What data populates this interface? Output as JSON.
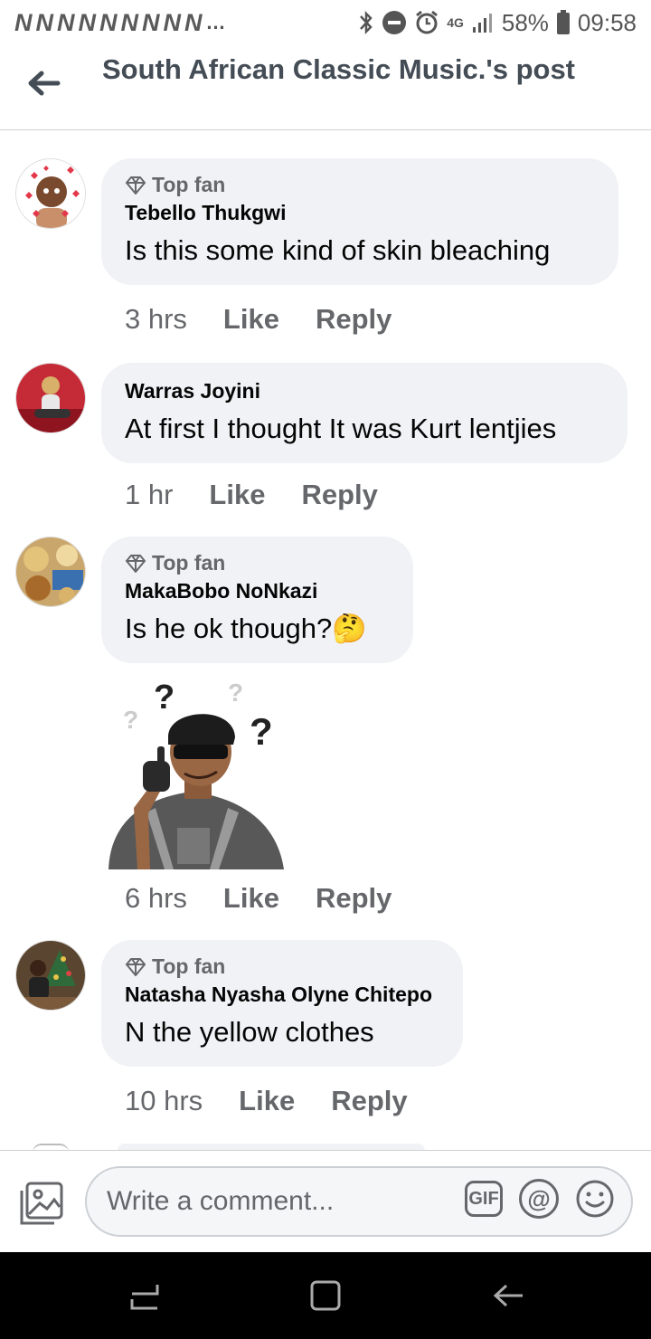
{
  "status_bar": {
    "notification_letters": [
      "N",
      "N",
      "N",
      "N",
      "N",
      "N",
      "N",
      "N",
      "N"
    ],
    "more": "…",
    "network": "4G",
    "battery": "58%",
    "time": "09:58"
  },
  "header": {
    "title": "South African Classic Music.'s post"
  },
  "comments": [
    {
      "top_fan": "Top fan",
      "name": "Tebello Thukgwi",
      "text": "Is this some kind of skin bleaching",
      "time": "3 hrs",
      "like": "Like",
      "reply": "Reply"
    },
    {
      "top_fan": "",
      "name": "Warras Joyini",
      "text": "At first I thought It was Kurt lentjies",
      "time": "1 hr",
      "like": "Like",
      "reply": "Reply"
    },
    {
      "top_fan": "Top fan",
      "name": "MakaBobo NoNkazi",
      "text": "Is he ok though?",
      "emoji": "🤔",
      "time": "6 hrs",
      "like": "Like",
      "reply": "Reply"
    },
    {
      "top_fan": "Top fan",
      "name": "Natasha Nyasha Olyne Chitepo",
      "text": "N the yellow clothes",
      "time": "10 hrs",
      "like": "Like",
      "reply": "Reply"
    }
  ],
  "sticker": {
    "question_marks": [
      "?",
      "?",
      "?",
      "?"
    ]
  },
  "composer": {
    "placeholder": "Write a comment...",
    "gif_label": "GIF",
    "mention_label": "@"
  }
}
